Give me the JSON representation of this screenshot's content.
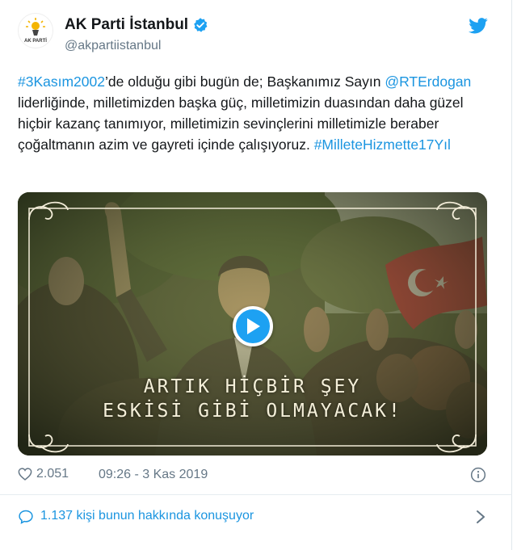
{
  "account": {
    "name": "AK Parti İstanbul",
    "handle": "@akpartiistanbul",
    "verified": true,
    "logo_text": "AK PARTİ"
  },
  "tweet": {
    "segments": [
      {
        "text": "#3Kasım2002",
        "link": true
      },
      {
        "text": "’de olduğu gibi bugün de; Başkanımız Sayın ",
        "link": false
      },
      {
        "text": "@RTErdogan",
        "link": true
      },
      {
        "text": " liderliğinde, milletimizden başka güç, milletimizin duasından daha güzel hiçbir kazanç tanımıyor, milletimizin sevinçlerini milletimizle beraber çoğaltmanın azim ve gayreti içinde çalışıyoruz. ",
        "link": false
      },
      {
        "text": "#MilleteHizmette17Yıl",
        "link": true
      }
    ]
  },
  "media": {
    "overlay_line1": "ARTIK HİÇBİR ŞEY",
    "overlay_line2": "ESKİSİ GİBİ OLMAYACAK!"
  },
  "meta": {
    "likes": "2.051",
    "timestamp": "09:26 - 3 Kas 2019"
  },
  "conversation": {
    "label": "1.137 kişi bunun hakkında konuşuyor"
  },
  "colors": {
    "link": "#1b95e0",
    "verified": "#1da1f2",
    "muted": "#657786"
  },
  "icons": [
    "ak-parti-logo-icon",
    "verified-badge-icon",
    "twitter-bird-icon",
    "play-icon",
    "heart-icon",
    "info-icon",
    "speech-bubble-icon",
    "chevron-right-icon"
  ]
}
